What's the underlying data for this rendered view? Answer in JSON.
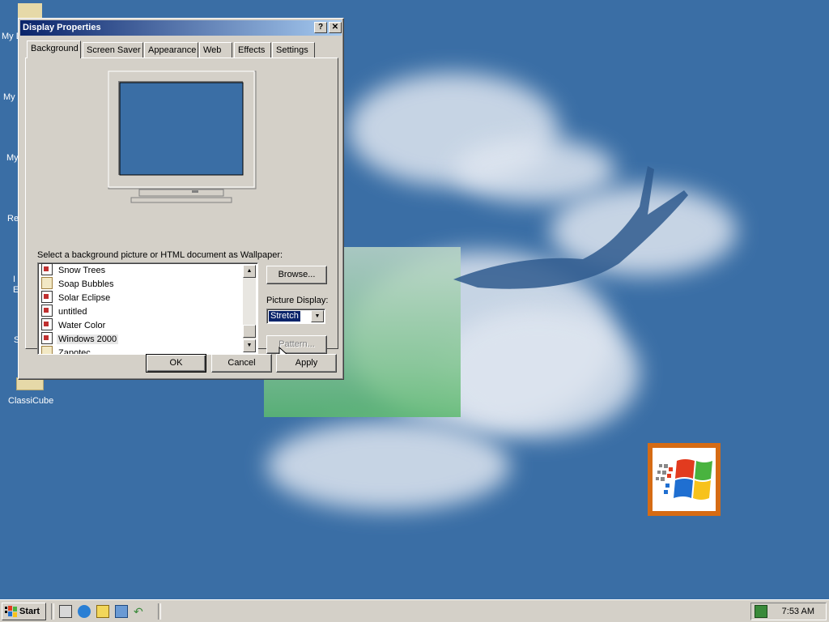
{
  "desktop": {
    "icons": [
      {
        "label": "My D"
      },
      {
        "label": "My"
      },
      {
        "label": "My"
      },
      {
        "label": "Re"
      },
      {
        "label": "I"
      },
      {
        "label": "E"
      },
      {
        "label": "S"
      },
      {
        "label": "ClassiCube"
      }
    ],
    "background_color": "#3a6ea5"
  },
  "dialog": {
    "title": "Display Properties",
    "help_button": "?",
    "close_button": "✕",
    "tabs": [
      {
        "label": "Background",
        "active": true
      },
      {
        "label": "Screen Saver"
      },
      {
        "label": "Appearance"
      },
      {
        "label": "Web"
      },
      {
        "label": "Effects"
      },
      {
        "label": "Settings"
      }
    ],
    "wallpaper_label": "Select a background picture or HTML document as Wallpaper:",
    "wallpapers": [
      {
        "name": "Snow Trees",
        "icon": "paint-document-icon"
      },
      {
        "name": "Soap Bubbles",
        "icon": "brush-document-icon"
      },
      {
        "name": "Solar Eclipse",
        "icon": "paint-document-icon"
      },
      {
        "name": "untitled",
        "icon": "paint-document-icon"
      },
      {
        "name": "Water Color",
        "icon": "paint-document-icon"
      },
      {
        "name": "Windows 2000",
        "icon": "paint-document-icon",
        "selected": true
      },
      {
        "name": "Zapotec",
        "icon": "brush-document-icon"
      }
    ],
    "browse_label": "Browse...",
    "picture_display_label": "Picture Display:",
    "picture_display_value": "Stretch",
    "pattern_label": "Pattern...",
    "ok_label": "OK",
    "cancel_label": "Cancel",
    "apply_label": "Apply"
  },
  "taskbar": {
    "start_label": "Start",
    "quick_launch": [
      "desktop-icon",
      "internet-explorer-icon",
      "outlook-express-icon",
      "folder-icon",
      "back-arrow-icon"
    ],
    "clock": "7:53 AM"
  }
}
